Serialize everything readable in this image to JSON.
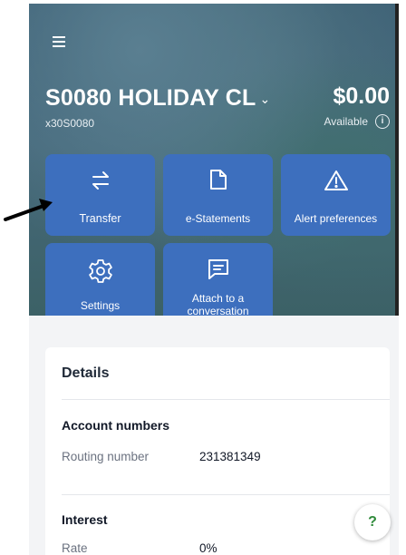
{
  "header": {
    "account_name": "S0080 HOLIDAY CL",
    "account_number": "x30S0080",
    "balance": "$0.00",
    "balance_label": "Available"
  },
  "actions": [
    {
      "label": "Transfer",
      "icon": "transfer-icon"
    },
    {
      "label": "e-Statements",
      "icon": "document-icon"
    },
    {
      "label": "Alert preferences",
      "icon": "warning-icon"
    },
    {
      "label": "Settings",
      "icon": "gear-icon"
    },
    {
      "label": "Attach to a conversation",
      "icon": "chat-icon"
    }
  ],
  "details": {
    "title": "Details",
    "account_numbers": {
      "title": "Account numbers",
      "routing_label": "Routing number",
      "routing_value": "231381349"
    },
    "interest": {
      "title": "Interest",
      "rate_label": "Rate",
      "rate_value": "0%"
    }
  },
  "help_label": "?",
  "colors": {
    "tile": "#3d6fbe",
    "help": "#2f8a3a"
  }
}
